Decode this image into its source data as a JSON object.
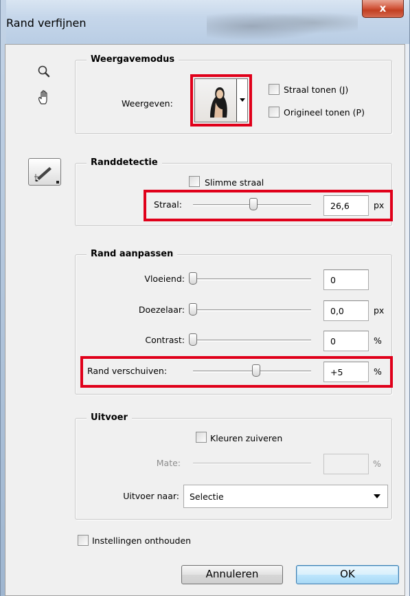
{
  "window": {
    "title": "Rand verfijnen",
    "close_label": "x"
  },
  "view_mode": {
    "legend": "Weergavemodus",
    "view_label": "Weergeven:",
    "show_radius_label": "Straal tonen (J)",
    "show_original_label": "Origineel tonen (P)"
  },
  "edge_detection": {
    "legend": "Randdetectie",
    "smart_radius_label": "Slimme straal",
    "radius_label": "Straal:",
    "radius_value": "26,6",
    "radius_unit": "px"
  },
  "adjust_edge": {
    "legend": "Rand aanpassen",
    "smooth_label": "Vloeiend:",
    "smooth_value": "0",
    "feather_label": "Doezelaar:",
    "feather_value": "0,0",
    "feather_unit": "px",
    "contrast_label": "Contrast:",
    "contrast_value": "0",
    "contrast_unit": "%",
    "shift_label": "Rand verschuiven:",
    "shift_value": "+5",
    "shift_unit": "%"
  },
  "output": {
    "legend": "Uitvoer",
    "decontaminate_label": "Kleuren zuiveren",
    "amount_label": "Mate:",
    "amount_value": "",
    "amount_unit": "%",
    "output_to_label": "Uitvoer naar:",
    "output_to_value": "Selectie"
  },
  "remember_label": "Instellingen onthouden",
  "buttons": {
    "cancel": "Annuleren",
    "ok": "OK"
  },
  "colors": {
    "highlight": "#e0001a",
    "ok_border": "#3c7fb1"
  }
}
